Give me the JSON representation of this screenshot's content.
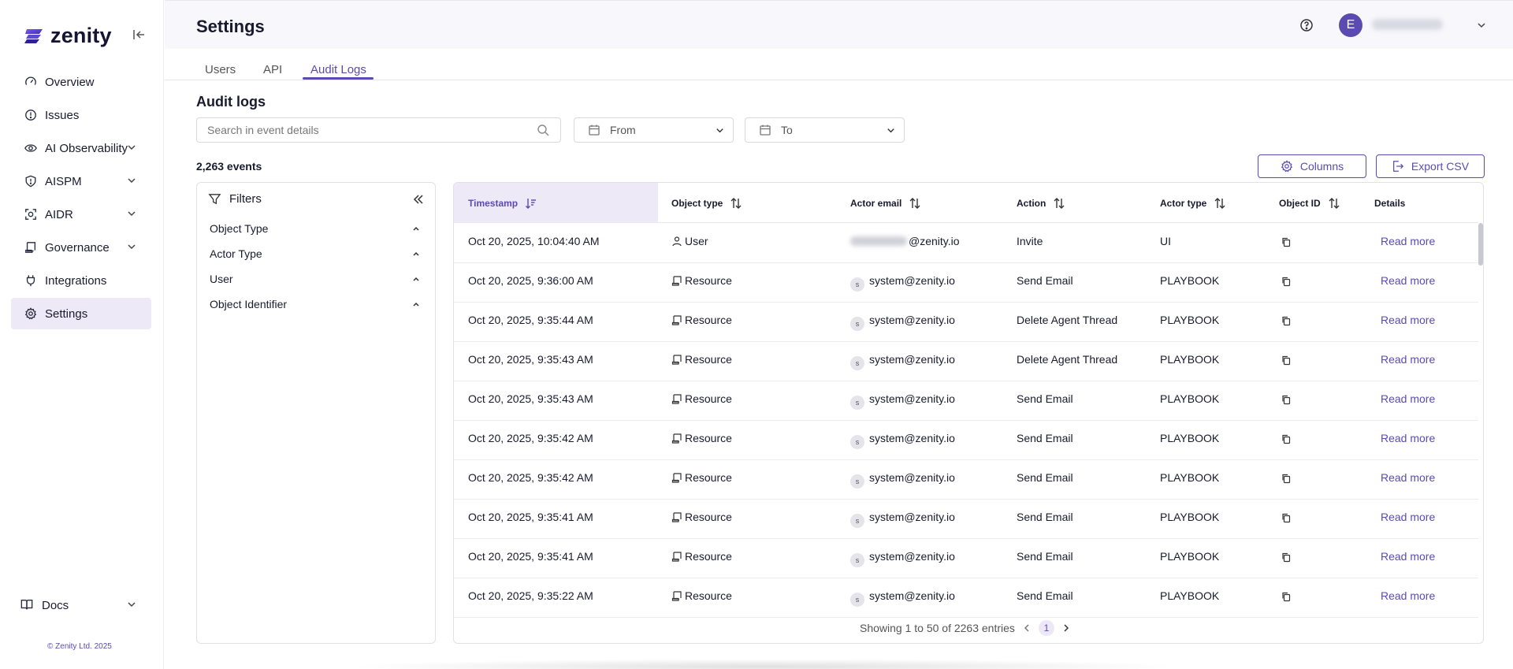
{
  "app": {
    "brand": "zenity",
    "accent_color": "#5b4bb0"
  },
  "sidebar": {
    "items": [
      {
        "label": "Overview",
        "icon": "gauge-icon",
        "has_chevron": false
      },
      {
        "label": "Issues",
        "icon": "alert-circle-icon",
        "has_chevron": false
      },
      {
        "label": "AI Observability",
        "icon": "eye-icon",
        "has_chevron": true
      },
      {
        "label": "AISPM",
        "icon": "shield-alert-icon",
        "has_chevron": true
      },
      {
        "label": "AIDR",
        "icon": "scan-icon",
        "has_chevron": true
      },
      {
        "label": "Governance",
        "icon": "scroll-icon",
        "has_chevron": true
      },
      {
        "label": "Integrations",
        "icon": "plug-icon",
        "has_chevron": false
      },
      {
        "label": "Settings",
        "icon": "gear-icon",
        "has_chevron": false,
        "active": true
      }
    ],
    "docs_label": "Docs",
    "copyright": "© Zenity Ltd. 2025"
  },
  "header": {
    "title": "Settings",
    "avatar_initial": "E"
  },
  "tabs": [
    {
      "label": "Users"
    },
    {
      "label": "API"
    },
    {
      "label": "Audit Logs",
      "active": true
    }
  ],
  "audit": {
    "title": "Audit logs",
    "search_placeholder": "Search in event details",
    "from_label": "From",
    "to_label": "To",
    "events_count": "2,263 events",
    "columns_button": "Columns",
    "export_button": "Export CSV"
  },
  "filters": {
    "title": "Filters",
    "items": [
      "Object Type",
      "Actor Type",
      "User",
      "Object Identifier"
    ]
  },
  "table": {
    "headers": [
      "Timestamp",
      "Object type",
      "Actor email",
      "Action",
      "Actor type",
      "Object ID",
      "Details"
    ],
    "rows": [
      {
        "timestamp": "Oct 20, 2025, 10:04:40 AM",
        "object_type": "User",
        "object_icon": "user-icon",
        "actor_email": "@zenity.io",
        "actor_blurred": true,
        "action": "Invite",
        "actor_type": "UI",
        "details": "Read more"
      },
      {
        "timestamp": "Oct 20, 2025, 9:36:00 AM",
        "object_type": "Resource",
        "object_icon": "resource-icon",
        "actor_email": "system@zenity.io",
        "actor_blurred": false,
        "action": "Send Email",
        "actor_type": "PLAYBOOK",
        "details": "Read more"
      },
      {
        "timestamp": "Oct 20, 2025, 9:35:44 AM",
        "object_type": "Resource",
        "object_icon": "resource-icon",
        "actor_email": "system@zenity.io",
        "actor_blurred": false,
        "action": "Delete Agent Thread",
        "actor_type": "PLAYBOOK",
        "details": "Read more"
      },
      {
        "timestamp": "Oct 20, 2025, 9:35:43 AM",
        "object_type": "Resource",
        "object_icon": "resource-icon",
        "actor_email": "system@zenity.io",
        "actor_blurred": false,
        "action": "Delete Agent Thread",
        "actor_type": "PLAYBOOK",
        "details": "Read more"
      },
      {
        "timestamp": "Oct 20, 2025, 9:35:43 AM",
        "object_type": "Resource",
        "object_icon": "resource-icon",
        "actor_email": "system@zenity.io",
        "actor_blurred": false,
        "action": "Send Email",
        "actor_type": "PLAYBOOK",
        "details": "Read more"
      },
      {
        "timestamp": "Oct 20, 2025, 9:35:42 AM",
        "object_type": "Resource",
        "object_icon": "resource-icon",
        "actor_email": "system@zenity.io",
        "actor_blurred": false,
        "action": "Send Email",
        "actor_type": "PLAYBOOK",
        "details": "Read more"
      },
      {
        "timestamp": "Oct 20, 2025, 9:35:42 AM",
        "object_type": "Resource",
        "object_icon": "resource-icon",
        "actor_email": "system@zenity.io",
        "actor_blurred": false,
        "action": "Send Email",
        "actor_type": "PLAYBOOK",
        "details": "Read more"
      },
      {
        "timestamp": "Oct 20, 2025, 9:35:41 AM",
        "object_type": "Resource",
        "object_icon": "resource-icon",
        "actor_email": "system@zenity.io",
        "actor_blurred": false,
        "action": "Send Email",
        "actor_type": "PLAYBOOK",
        "details": "Read more"
      },
      {
        "timestamp": "Oct 20, 2025, 9:35:41 AM",
        "object_type": "Resource",
        "object_icon": "resource-icon",
        "actor_email": "system@zenity.io",
        "actor_blurred": false,
        "action": "Send Email",
        "actor_type": "PLAYBOOK",
        "details": "Read more"
      },
      {
        "timestamp": "Oct 20, 2025, 9:35:22 AM",
        "object_type": "Resource",
        "object_icon": "resource-icon",
        "actor_email": "system@zenity.io",
        "actor_blurred": false,
        "action": "Send Email",
        "actor_type": "PLAYBOOK",
        "details": "Read more"
      }
    ],
    "system_badge": "s",
    "pagination_text": "Showing 1 to 50 of 2263 entries",
    "current_page": "1"
  }
}
